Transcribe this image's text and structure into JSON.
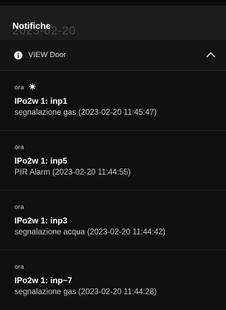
{
  "header": {
    "title": "Notifiche",
    "ghost_text": "2023-02-20"
  },
  "group": {
    "icon": "info-icon",
    "label": "VIEW Door",
    "toggle_icon": "chevron-up-icon"
  },
  "notifications": [
    {
      "time": "ora",
      "title": "IPo2w 1: inp1",
      "body": "segnalazione gas (2023-02-20 11:45:47)"
    },
    {
      "time": "ora",
      "title": "IPo2w 1: inp5",
      "body": "PIR Alarm (2023-02-20 11:44:55)"
    },
    {
      "time": "ora",
      "title": "IPo2w 1: inp3",
      "body": "segnalazione acqua (2023-02-20 11:44:42)"
    },
    {
      "time": "ora",
      "title": "IPo2w 1: inp~7",
      "body": "segnalazione gas (2023-02-20 11:44:28)"
    }
  ]
}
